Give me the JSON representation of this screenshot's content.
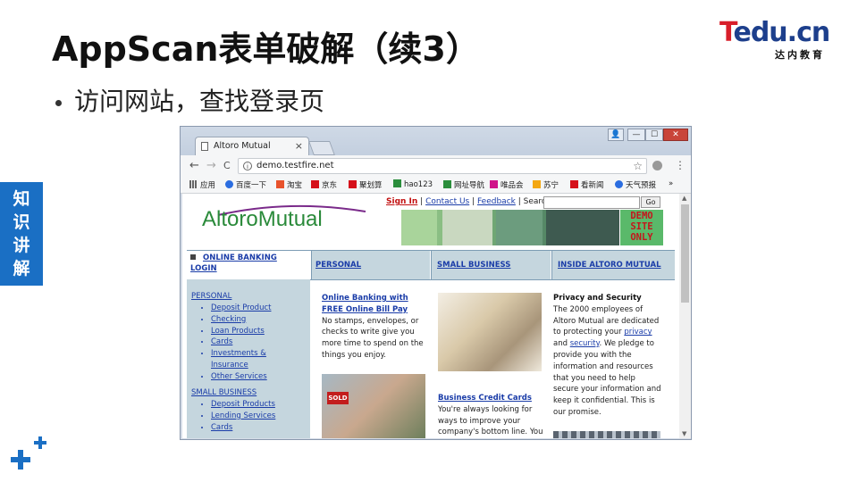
{
  "slide": {
    "title": "AppScan表单破解（续3）",
    "bullet": "访问网站，查找登录页",
    "side_tag": [
      "知",
      "识",
      "讲",
      "解"
    ]
  },
  "logo": {
    "t": "T",
    "edu": "edu",
    "cn": ".cn",
    "subtitle": "达内教育",
    "colors": {
      "red": "#d81e2a",
      "blue": "#1d3f8c"
    }
  },
  "browser": {
    "tab_title": "Altoro Mutual",
    "tab_close": "×",
    "nav": {
      "back": "←",
      "forward": "→",
      "reload": "C"
    },
    "url": "demo.testfire.net",
    "window_buttons": {
      "user": "👤",
      "minimize": "—",
      "maximize": "☐",
      "close": "✕"
    },
    "bookmarks": [
      {
        "label": "应用",
        "color": "#666666"
      },
      {
        "label": "百度一下",
        "color": "#2b6de0"
      },
      {
        "label": "淘宝",
        "color": "#e8532c"
      },
      {
        "label": "京东",
        "color": "#d5101a"
      },
      {
        "label": "聚划算",
        "color": "#d5101a"
      },
      {
        "label": "hao123",
        "color": "#2b8e3c"
      },
      {
        "label": "网址导航",
        "color": "#2b8e3c"
      },
      {
        "label": "唯品会",
        "color": "#d0148a"
      },
      {
        "label": "苏宁",
        "color": "#f3a712"
      },
      {
        "label": "看新闻",
        "color": "#d5101a"
      },
      {
        "label": "天气预报",
        "color": "#2b6de0"
      }
    ],
    "bookmarks_more": "»"
  },
  "site": {
    "sign_in": "Sign In",
    "contact_us": "Contact Us",
    "feedback": "Feedback",
    "search_label": "Search",
    "go": "Go",
    "logo_altoro": "Altoro",
    "logo_mutual": "Mutual",
    "demo_only": [
      "DEMO",
      "SITE",
      "ONLY"
    ],
    "nav": {
      "online_banking": "ONLINE BANKING",
      "login": "LOGIN",
      "personal": "PERSONAL",
      "small_business": "SMALL BUSINESS",
      "inside": "INSIDE ALTORO MUTUAL"
    },
    "left": {
      "personal": "PERSONAL",
      "personal_items": [
        "Deposit Product",
        "Checking",
        "Loan Products",
        "Cards",
        "Investments &",
        "Insurance",
        "Other Services"
      ],
      "small_business": "SMALL BUSINESS",
      "business_items": [
        "Deposit Products",
        "Lending Services",
        "Cards"
      ]
    },
    "col1": {
      "head1": "Online Banking with",
      "head2": "FREE Online Bill Pay",
      "lines": [
        "No stamps, envelopes, or",
        "checks to write give you",
        "more time to spend on the",
        "things you enjoy."
      ]
    },
    "col2": {
      "head": "Business Credit Cards",
      "lines": [
        "You're always looking for",
        "ways to improve your",
        "company's bottom line. You"
      ]
    },
    "col3": {
      "head": "Privacy and Security",
      "l1": "The 2000 employees of",
      "l2": "Altoro Mutual are dedicated",
      "l3": "to protecting your",
      "privacy": "privacy",
      "and": "and",
      "security": "security",
      "l4": ". We pledge to",
      "lines": [
        "provide you with the",
        "information and resources",
        "that you need to help",
        "secure your information and",
        "keep it confidential. This is",
        "our promise."
      ]
    },
    "sold_sign": "SOLD"
  }
}
